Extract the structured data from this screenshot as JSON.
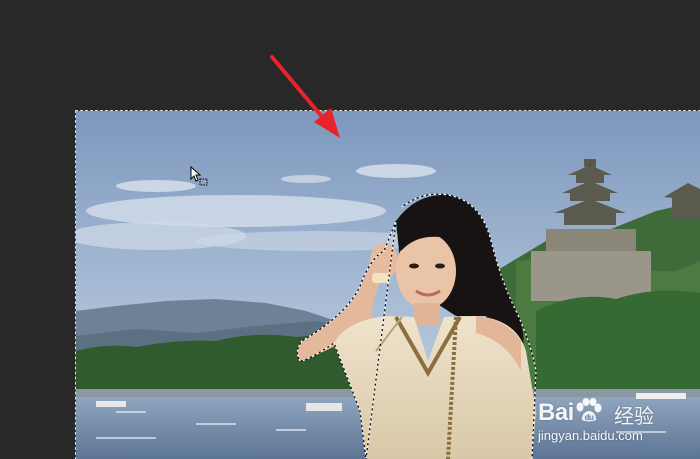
{
  "workspace": {
    "background": "#282828"
  },
  "document": {
    "selection": "marching-ants",
    "image_subject": "photo"
  },
  "annotation": {
    "arrow_color": "#e8242a",
    "icon": "arrow-icon"
  },
  "cursor": {
    "icon": "marquee-add-cursor-icon"
  },
  "watermark": {
    "logo_text": "Bai",
    "logo_suffix": "经验",
    "url": "jingyan.baidu.com"
  }
}
